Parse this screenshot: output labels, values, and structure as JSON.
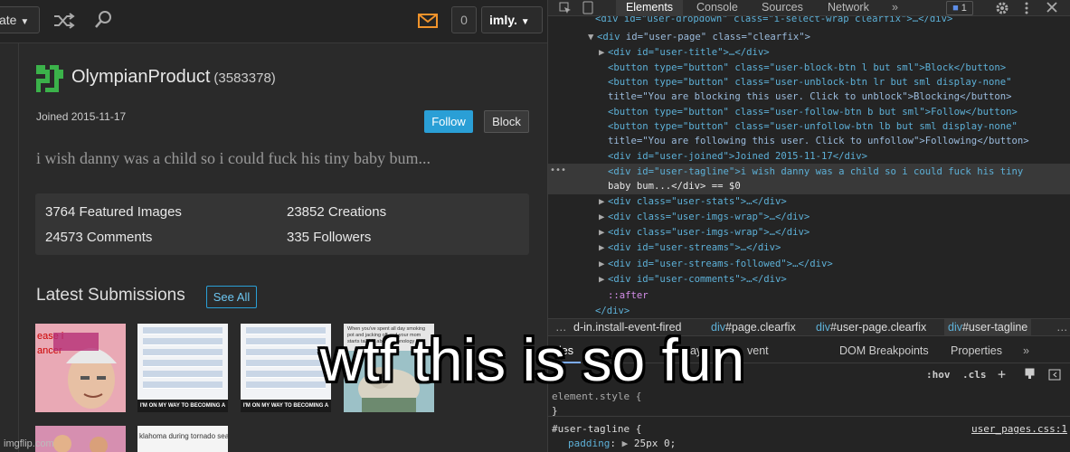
{
  "site": {
    "create_label": "ate",
    "notif_count": "0",
    "user_menu": "imly."
  },
  "profile": {
    "username": "OlympianProduct",
    "user_id": "(3583378)",
    "joined": "Joined 2015-11-17",
    "follow_label": "Follow",
    "block_label": "Block",
    "tagline": "i wish danny was a child so i could fuck his tiny baby bum...",
    "stats": {
      "featured": "3764 Featured Images",
      "creations": "23852 Creations",
      "comments": "24573 Comments",
      "followers": "335 Followers"
    },
    "latest_title": "Latest Submissions",
    "see_all": "See All",
    "thumbs": {
      "t1_text_a": "ease i",
      "t1_text_b": "ancer",
      "t2_caption": "I'M ON MY WAY TO BECOMING A MILLIONAIRE",
      "t3_caption": "I'M ON MY WAY TO BECOMING A MILLIONAIRE",
      "t4_text": "When you've spent all day smoking pot and jacking off and your mom starts talking about technology",
      "t6_text": "klahoma during tornado seaso"
    }
  },
  "devtools": {
    "tabs": {
      "elements": "Elements",
      "console": "Console",
      "sources": "Sources",
      "network": "Network",
      "more": "»"
    },
    "issues_count": "1",
    "dom": {
      "l0": "<div id=\"user-dropdown\" class=\"i-select-wrap clearfix\">…</div>",
      "l1_open": "<div ",
      "l1_attrs": "id=\"user-page\" class=\"clearfix\">",
      "l2": "<div id=\"user-title\">…</div>",
      "l3": "<button type=\"button\" class=\"user-block-btn l but sml\">Block</button>",
      "l4": "<button type=\"button\" class=\"user-unblock-btn lr but sml display-none\"",
      "l5": "title=\"You are blocking this user. Click to unblock\">Blocking</button>",
      "l6": "<button type=\"button\" class=\"user-follow-btn b but sml\">Follow</button>",
      "l7": "<button type=\"button\" class=\"user-unfollow-btn lb but sml display-none\"",
      "l8": "title=\"You are following this user. Click to unfollow\">Following</button>",
      "l9": "<div id=\"user-joined\">Joined 2015-11-17</div>",
      "l10": "<div id=\"user-tagline\">i wish danny was a child so i could fuck his tiny",
      "l11": "baby bum...</div> == $0",
      "l12": "<div class=\"user-stats\">…</div>",
      "l13": "<div class=\"user-imgs-wrap\">…</div>",
      "l14": "<div class=\"user-imgs-wrap\">…</div>",
      "l15": "<div id=\"user-streams\">…</div>",
      "l16": "<div id=\"user-streams-followed\">…</div>",
      "l17": "<div id=\"user-comments\">…</div>",
      "l18": "::after",
      "l19": "</div>"
    },
    "breadcrumbs": {
      "more_left": "…",
      "c1": "d-in.install-event-fired",
      "c2_tag": "div",
      "c2_rest": "#page.clearfix",
      "c3_tag": "div",
      "c3_rest": "#user-page.clearfix",
      "c4_tag": "div",
      "c4_rest": "#user-tagline",
      "more_right": "…"
    },
    "styles_tabs": {
      "styles": "les",
      "computed": "Co",
      "layout": "Layo",
      "event": "vent",
      "dom_breakpoints": "DOM Breakpoints",
      "properties": "Properties",
      "more": "»"
    },
    "filter": {
      "hov": ":hov",
      ".cls": ".cls",
      "plus": "+"
    },
    "rules": {
      "element_style": "element.style {",
      "close1": "}",
      "selector": "#user-tagline {",
      "prop": "padding",
      "value": "25px 0;",
      "source": "user_pages.css:1"
    }
  },
  "caption": "wtf this is so fun",
  "watermark": "imgflip.com"
}
